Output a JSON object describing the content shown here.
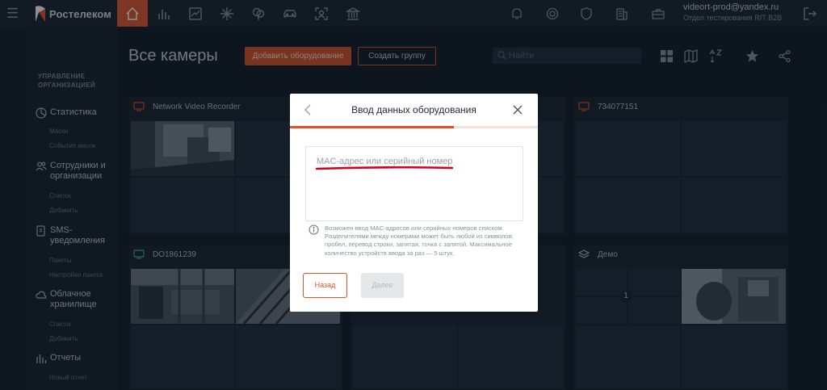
{
  "topbar": {
    "logo_text": "Ростелеком",
    "nav_icons": [
      "home-icon",
      "bar-chart-icon",
      "line-chart-icon",
      "snowflake-icon",
      "tree-icon",
      "car-icon",
      "face-scan-icon",
      "bank-icon"
    ],
    "right_icons": [
      "bell-icon",
      "support-icon",
      "shield-icon",
      "building-icon",
      "briefcase-icon"
    ],
    "user_email": "videort-prod@yandex.ru",
    "user_org": "Отдел тестирования RIT B2B",
    "accent_color": "#e15a33"
  },
  "sidebar": {
    "heading": "УПРАВЛЕНИЕ ОРГАНИЗАЦИЕЙ",
    "items": [
      {
        "label": "Статистика",
        "icon": "pie-chart-icon",
        "subs": [
          "Маски",
          "События масок"
        ]
      },
      {
        "label": "Сотрудники и организации",
        "icon": "users-icon",
        "subs": [
          "Список",
          "Добавить"
        ]
      },
      {
        "label": "SMS-уведомления",
        "icon": "sms-icon",
        "subs": [
          "Пакеты",
          "Настройки пакета"
        ]
      },
      {
        "label": "Облачное хранилище",
        "icon": "cloud-icon",
        "subs": [
          "Список",
          "Добавить"
        ]
      },
      {
        "label": "Отчеты",
        "icon": "reports-icon",
        "subs": [
          "Новый отчет"
        ]
      }
    ]
  },
  "main": {
    "title": "Все камеры",
    "add_button": "Добавить оборудование",
    "group_button": "Создать группу",
    "search_placeholder": "Найти",
    "view_icons": [
      "grid-icon",
      "map-icon",
      "sort-icon",
      "star-icon",
      "share-icon"
    ]
  },
  "groups": [
    {
      "name": "Network Video Recorder",
      "icon": "recorder-icon"
    },
    {
      "name": "734077151",
      "icon": "recorder-icon"
    },
    {
      "name": "DO1861239",
      "icon": "camera-icon"
    },
    {
      "name": "Демо",
      "icon": "layers-icon",
      "badge": "1"
    }
  ],
  "modal": {
    "title": "Ввод данных оборудования",
    "progress": 0.66,
    "input_placeholder": "MAC-адрес или серийный номер",
    "hint": "Возможен ввод MAC-адресов или серийных номеров списком. Разделителями между номерами может быть любой из символов: пробел, перевод строки, запятая, точка с запятой. Максимальное количество устройств ввода за раз — 5 штук.",
    "back_button": "Назад",
    "next_button": "Далее"
  }
}
